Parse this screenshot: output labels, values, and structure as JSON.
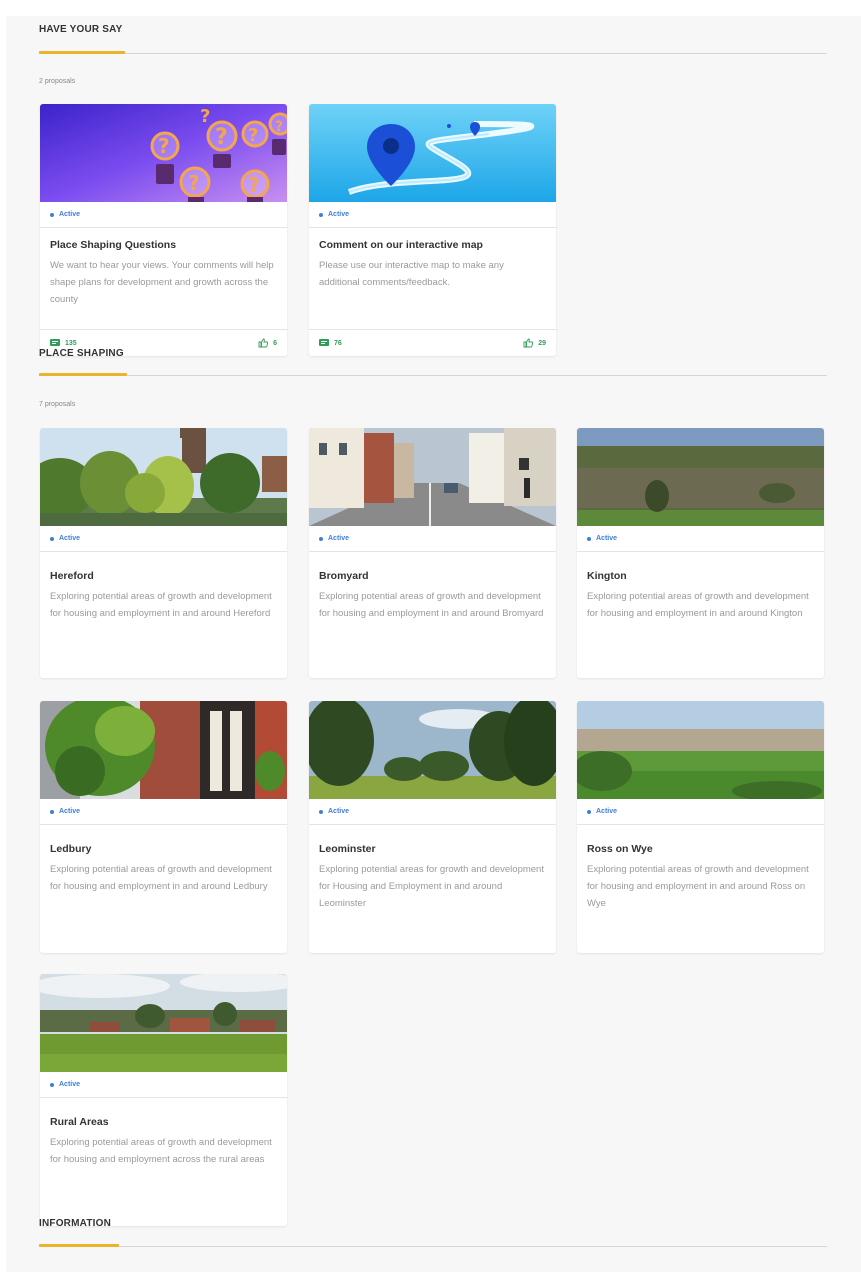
{
  "sections": [
    {
      "title": "HAVE YOUR SAY",
      "count": "2 proposals",
      "cards": [
        {
          "status": "Active",
          "title": "Place Shaping Questions",
          "desc": "We want to hear your views. Your comments will help shape plans for development and growth across the county",
          "comments": "135",
          "likes": "6"
        },
        {
          "status": "Active",
          "title": "Comment on our interactive map",
          "desc": "Please use our interactive map to make any additional comments/feedback.",
          "comments": "76",
          "likes": "29"
        }
      ]
    },
    {
      "title": "PLACE SHAPING",
      "count": "7 proposals",
      "cards": [
        {
          "status": "Active",
          "title": "Hereford",
          "desc": "Exploring potential areas of growth and development for housing and employment in and around Hereford"
        },
        {
          "status": "Active",
          "title": "Bromyard",
          "desc": "Exploring potential areas of growth and development for housing and employment in and around Bromyard"
        },
        {
          "status": "Active",
          "title": "Kington",
          "desc": "Exploring potential areas of growth and development for housing and employment in and around Kington"
        },
        {
          "status": "Active",
          "title": "Ledbury",
          "desc": "Exploring potential areas of growth and development for housing and employment in and around Ledbury"
        },
        {
          "status": "Active",
          "title": "Leominster",
          "desc": "Exploring potential areas for growth and development for Housing and Employment in and around Leominster"
        },
        {
          "status": "Active",
          "title": "Ross on Wye",
          "desc": "Exploring potential areas of growth and development for housing and employment in and around Ross on Wye"
        },
        {
          "status": "Active",
          "title": "Rural Areas",
          "desc": "Exploring potential areas of growth and development for housing and employment across the rural areas"
        }
      ]
    },
    {
      "title": "INFORMATION"
    }
  ],
  "colors": {
    "accent": "#e9b42a",
    "status": "#3f80d6",
    "engagement": "#2f9e59"
  }
}
